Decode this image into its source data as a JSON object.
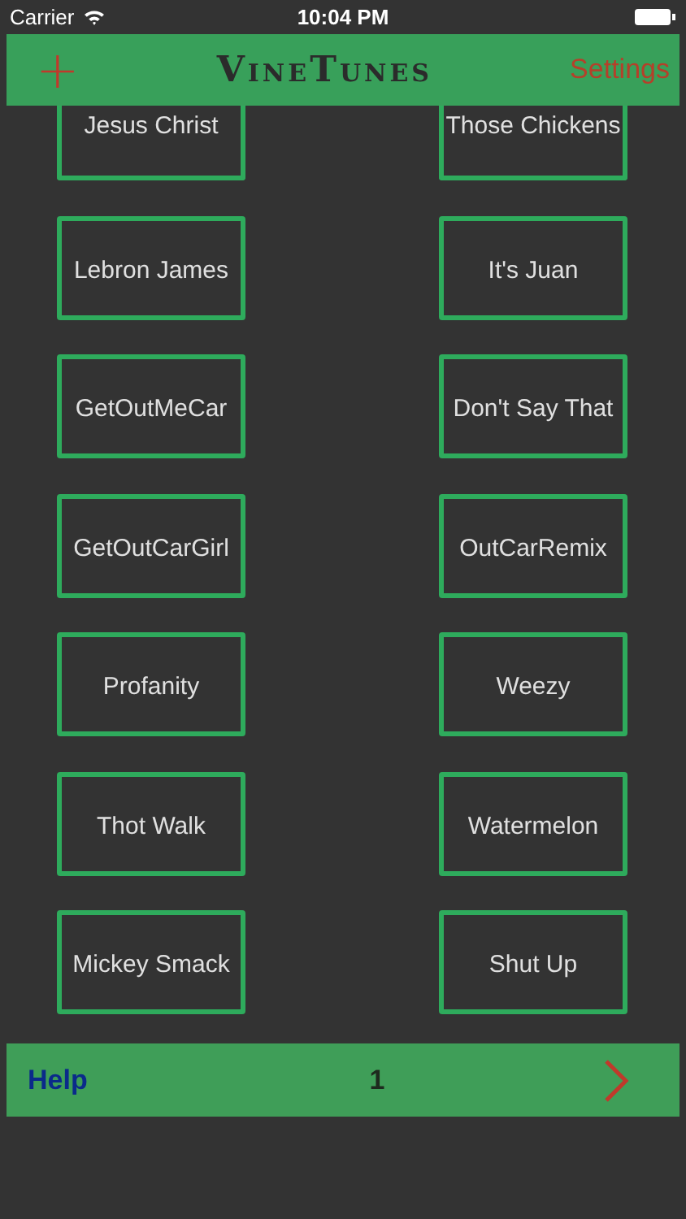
{
  "status_bar": {
    "carrier": "Carrier",
    "time": "10:04 PM"
  },
  "nav_bar": {
    "add": "+",
    "title": "VineTunes",
    "settings": "Settings"
  },
  "sounds": [
    {
      "label": "Jesus Christ"
    },
    {
      "label": "Those Chickens"
    },
    {
      "label": "Lebron James"
    },
    {
      "label": "It's Juan"
    },
    {
      "label": "GetOutMeCar"
    },
    {
      "label": "Don't Say That"
    },
    {
      "label": "GetOutCarGirl"
    },
    {
      "label": "OutCarRemix"
    },
    {
      "label": "Profanity"
    },
    {
      "label": "Weezy"
    },
    {
      "label": "Thot Walk"
    },
    {
      "label": "Watermelon"
    },
    {
      "label": "Mickey Smack"
    },
    {
      "label": "Shut Up"
    }
  ],
  "bottom_bar": {
    "help": "Help",
    "page": "1"
  }
}
